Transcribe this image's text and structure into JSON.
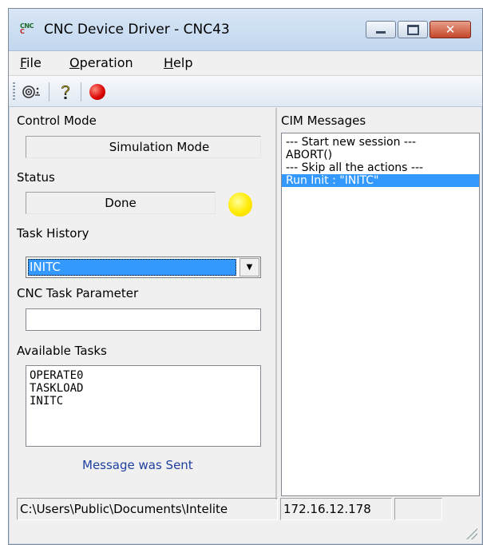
{
  "window": {
    "title": "CNC Device Driver - CNC43",
    "app_icon_top": "CNC",
    "app_icon_bottom": "C"
  },
  "menu": {
    "items": [
      {
        "underline": "F",
        "rest": "ile"
      },
      {
        "underline": "O",
        "rest": "peration"
      },
      {
        "underline": "H",
        "rest": "elp"
      }
    ]
  },
  "toolbar": {
    "buttons": [
      {
        "icon": "settings-icon",
        "glyph": "◎⁝"
      },
      {
        "icon": "help-icon",
        "glyph": "❔"
      },
      {
        "icon": "stop-icon",
        "color": "#d80000"
      }
    ]
  },
  "left": {
    "control_mode_label": "Control Mode",
    "control_mode_value": "Simulation Mode",
    "status_label": "Status",
    "status_value": "Done",
    "status_indicator_color": "#ffea00",
    "task_history_label": "Task History",
    "task_history_value": "INITC",
    "task_param_label": "CNC Task Parameter",
    "task_param_value": "",
    "available_tasks_label": "Available Tasks",
    "available_tasks": [
      "OPERATE0",
      "TASKLOAD",
      "INITC"
    ],
    "message_text": "Message was Sent"
  },
  "right": {
    "cim_label": "CIM Messages",
    "messages": [
      {
        "text": "--- Start new session ---",
        "selected": false
      },
      {
        "text": "ABORT()",
        "selected": false
      },
      {
        "text": "--- Skip all the actions ---",
        "selected": false
      },
      {
        "text": "Run Init : \"INITC\"",
        "selected": true
      }
    ]
  },
  "statusbar": {
    "path": "C:\\Users\\Public\\Documents\\Intelite",
    "ip": "172.16.12.178",
    "extra": ""
  },
  "colors": {
    "selection": "#3399ff",
    "message_text": "#1f3fa0"
  }
}
